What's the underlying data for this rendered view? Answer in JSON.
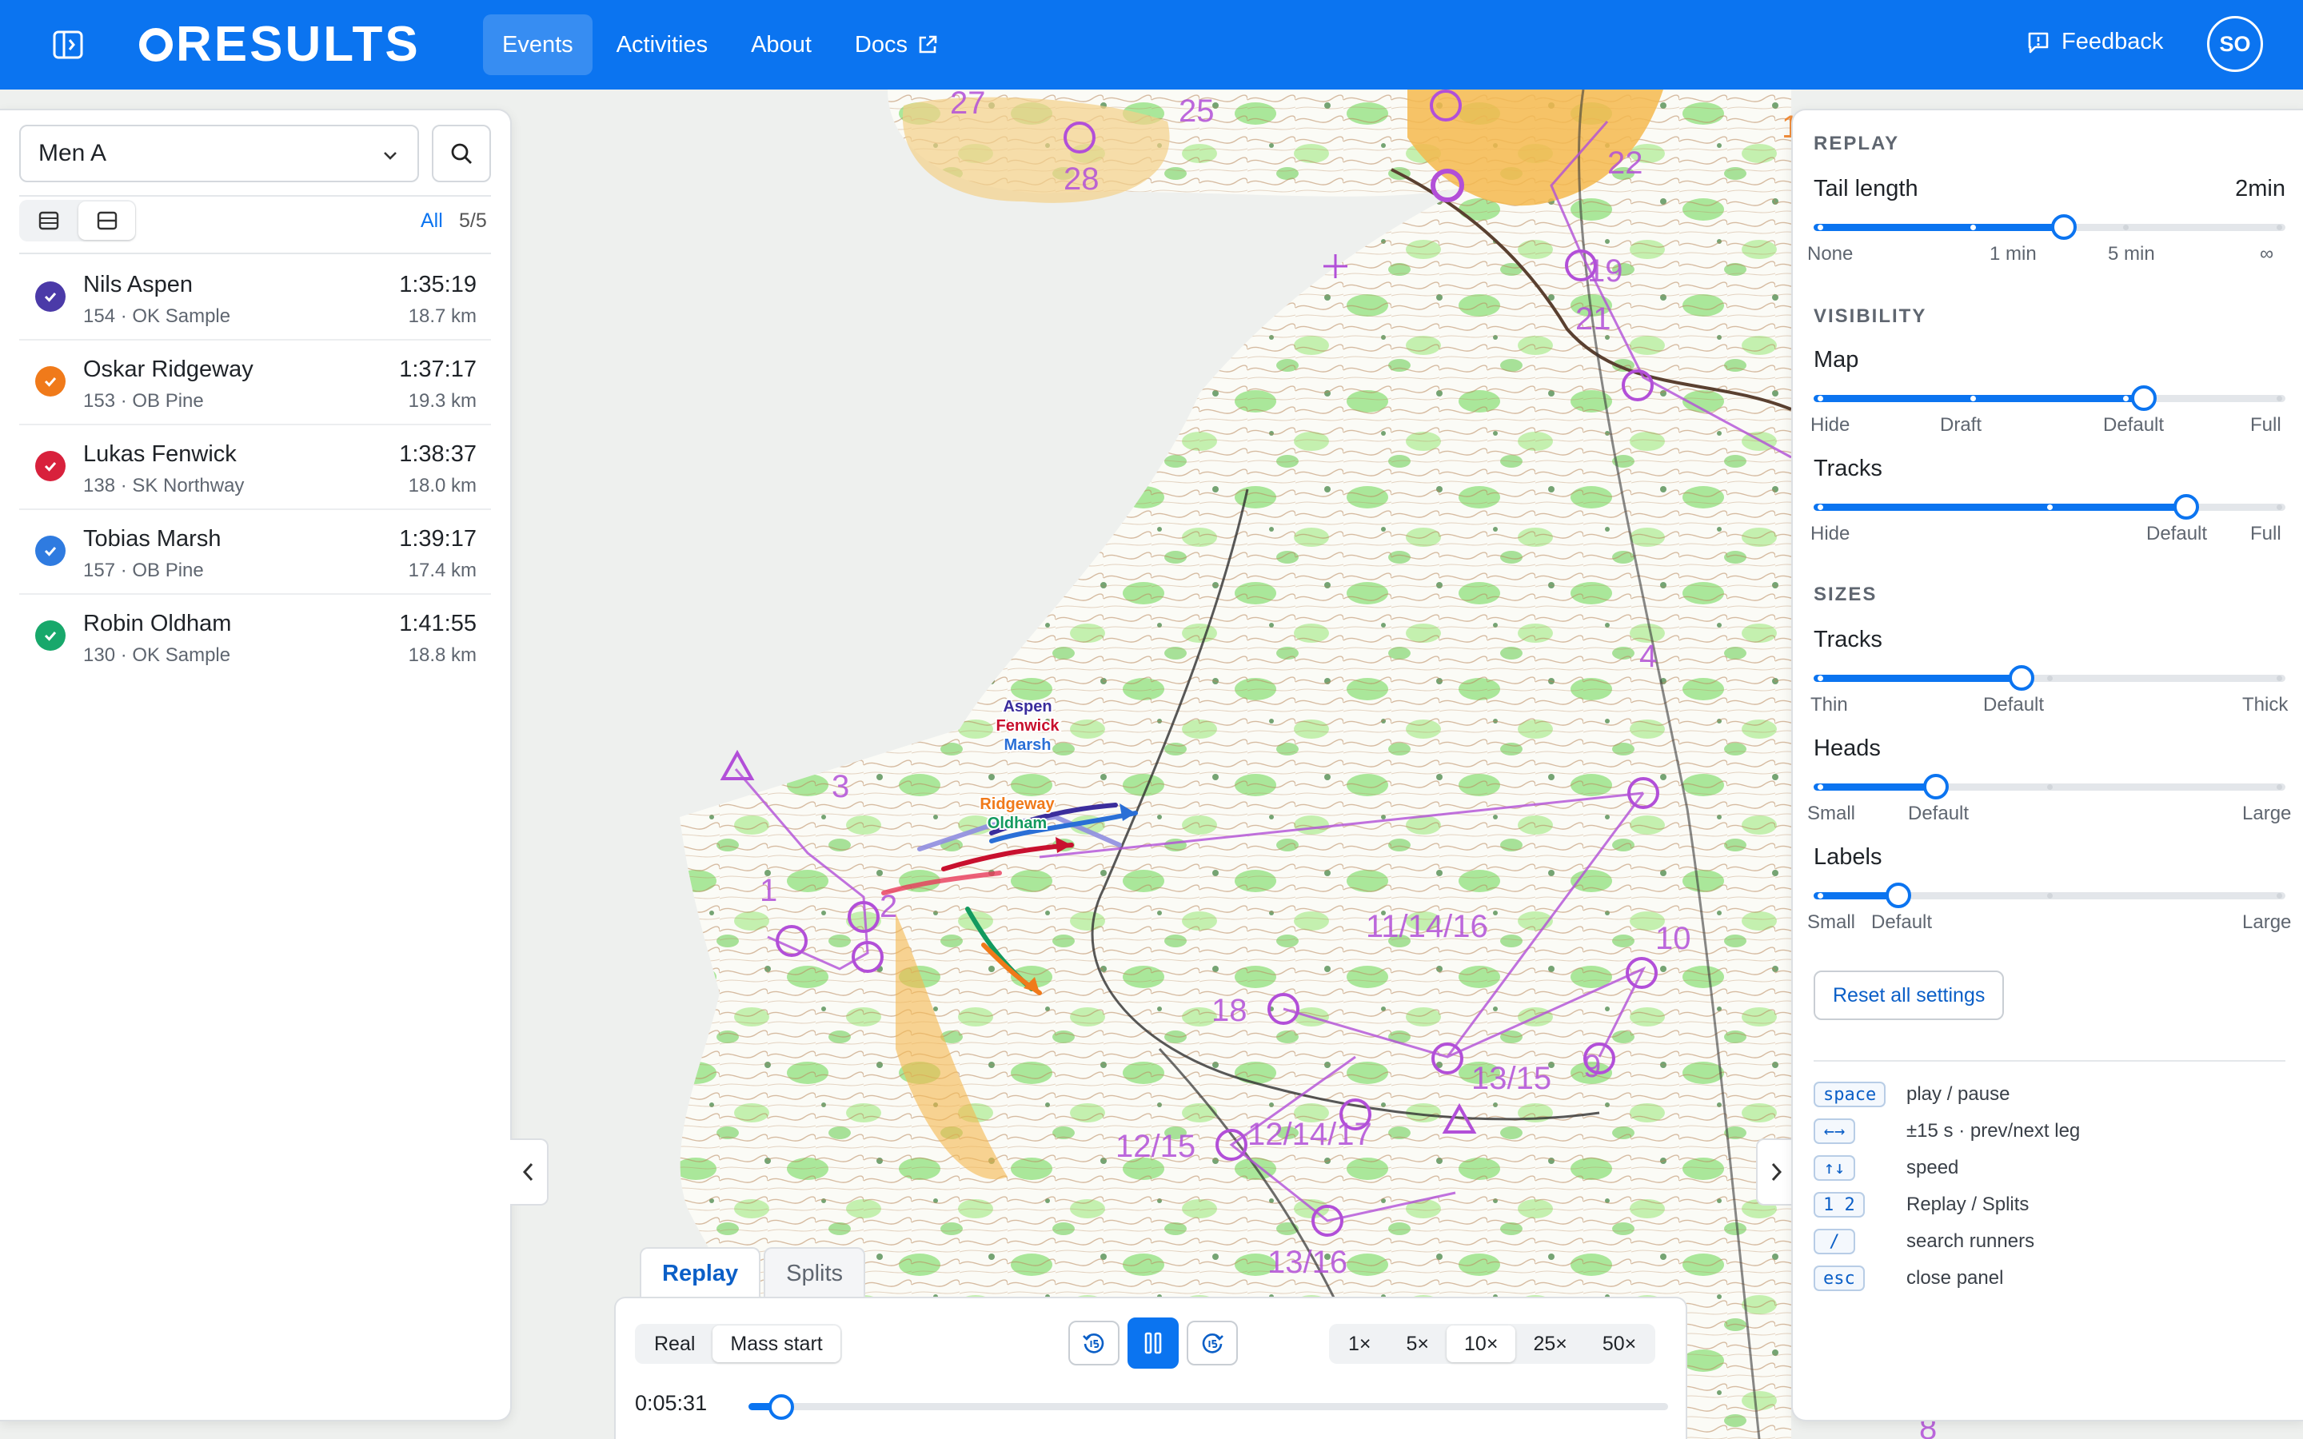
{
  "app": {
    "logo_text": "RESULTS",
    "user_initials": "SO",
    "feedback_label": "Feedback"
  },
  "nav": [
    {
      "label": "Events",
      "active": true
    },
    {
      "label": "Activities",
      "active": false
    },
    {
      "label": "About",
      "active": false
    },
    {
      "label": "Docs",
      "active": false,
      "external": true
    }
  ],
  "left_panel": {
    "class_select": "Men A",
    "filter_all": "All",
    "filter_count": "5/5",
    "runners": [
      {
        "name": "Nils Aspen",
        "club": "154 · OK Sample",
        "time": "1:35:19",
        "distance": "18.7 km",
        "color": "#4b3aa8"
      },
      {
        "name": "Oskar Ridgeway",
        "club": "153 · OB Pine",
        "time": "1:37:17",
        "distance": "19.3 km",
        "color": "#f07a1a"
      },
      {
        "name": "Lukas Fenwick",
        "club": "138 · SK Northway",
        "time": "1:38:37",
        "distance": "18.0 km",
        "color": "#d8213c"
      },
      {
        "name": "Tobias Marsh",
        "club": "157 · OB Pine",
        "time": "1:39:17",
        "distance": "17.4 km",
        "color": "#2f7be0"
      },
      {
        "name": "Robin Oldham",
        "club": "130 · OK Sample",
        "time": "1:41:55",
        "distance": "18.8 km",
        "color": "#18a86b"
      }
    ]
  },
  "map": {
    "runner_labels": [
      {
        "text": "Aspen",
        "color": "#3b2d9c"
      },
      {
        "text": "Fenwick",
        "color": "#c8102e"
      },
      {
        "text": "Marsh",
        "color": "#2a6fd6"
      },
      {
        "text": "Ridgeway",
        "color": "#f07a1a"
      },
      {
        "text": "Oldham",
        "color": "#139a5f"
      }
    ],
    "control_labels": [
      "27",
      "25",
      "28",
      "22",
      "19",
      "21",
      "3",
      "1",
      "2",
      "4",
      "11/14/16",
      "10",
      "18",
      "9",
      "13/15",
      "12/15",
      "12/14/17",
      "13/16",
      "1",
      "8"
    ]
  },
  "settings": {
    "replay": {
      "section": "REPLAY",
      "tail_label": "Tail length",
      "tail_value": "2min",
      "tail_ticks": [
        "None",
        "1 min",
        "5 min",
        "∞"
      ],
      "tail_level": 0.53
    },
    "visibility": {
      "section": "VISIBILITY",
      "map_label": "Map",
      "map_ticks": [
        "Hide",
        "Draft",
        "Default",
        "Full"
      ],
      "map_level": 0.7,
      "tracks_label": "Tracks",
      "tracks_ticks": [
        "Hide",
        "Default",
        "Full"
      ],
      "tracks_level": 0.79
    },
    "sizes": {
      "section": "SIZES",
      "tracks_label": "Tracks",
      "tracks_ticks": [
        "Thin",
        "Default",
        "Thick"
      ],
      "tracks_level": 0.44,
      "heads_label": "Heads",
      "heads_ticks": [
        "Small",
        "Default",
        "Large"
      ],
      "heads_level": 0.26,
      "labels_label": "Labels",
      "labels_ticks": [
        "Small",
        "Default",
        "Large"
      ],
      "labels_level": 0.18
    },
    "reset_label": "Reset all settings",
    "shortcuts": [
      {
        "key": "space",
        "desc": "play / pause"
      },
      {
        "key": "←→",
        "desc": "±15 s · prev/next leg"
      },
      {
        "key": "↑↓",
        "desc": "speed"
      },
      {
        "key": "1 2",
        "desc": "Replay / Splits"
      },
      {
        "key": "/",
        "desc": "search runners"
      },
      {
        "key": "esc",
        "desc": "close panel"
      }
    ]
  },
  "player": {
    "tabs": [
      {
        "label": "Replay",
        "active": true
      },
      {
        "label": "Splits",
        "active": false
      }
    ],
    "modes": [
      {
        "label": "Real",
        "active": false
      },
      {
        "label": "Mass start",
        "active": true
      }
    ],
    "speeds": [
      {
        "label": "1×",
        "active": false
      },
      {
        "label": "5×",
        "active": false
      },
      {
        "label": "10×",
        "active": true
      },
      {
        "label": "25×",
        "active": false
      },
      {
        "label": "50×",
        "active": false
      }
    ],
    "back_icon": "rewind-15-icon",
    "play_icon": "pause-icon",
    "forward_icon": "forward-15-icon",
    "current_time": "0:05:31",
    "progress": 0.036
  }
}
